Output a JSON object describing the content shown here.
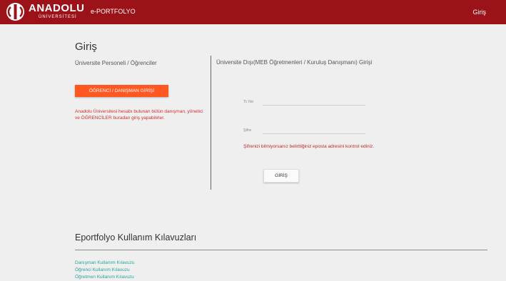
{
  "header": {
    "logo_icon": "anadolu-university-logo-icon",
    "logo_name": "ANADOLU",
    "logo_subtitle": "ÜNİVERSİTESİ",
    "brand_title": "e-PORTFOLYO",
    "nav_login": "Giriş",
    "bar_color": "#9b1218"
  },
  "main": {
    "title": "Giriş",
    "left": {
      "subtitle": "Üniversite Personeli / Öğrenciler",
      "button_label": "ÖĞRENCİ / DANIŞMAN GİRİŞİ",
      "note": "Anadolu Üniversitesi hesabı bulunan bütün danışman, yönetici ve ÖĞRENCİLER buradan giriş yapabilirler."
    },
    "right": {
      "subtitle": "Üniversite Dışı(MEB Öğretmenleri / Kuruluş Danışmanı) Girişi",
      "tc_label": "Tc No",
      "tc_value": "",
      "password_label": "Şifre",
      "password_value": "",
      "password_note": "Şifrenizi bilmiyorsanız belirttiğiniz eposta adresini kontrol ediniz.",
      "button_label": "GİRİŞ"
    }
  },
  "guides": {
    "title": "Eportfolyo Kullanım Kılavuzları",
    "links": [
      "Danışman Kullanım Kılavuzu",
      "Öğrenci Kullanım Kılavuzu",
      "Öğretmen Kullanım Kılavuzu"
    ]
  },
  "colors": {
    "accent": "#ff5722",
    "link": "#26a69a",
    "error": "#d32f2f"
  }
}
